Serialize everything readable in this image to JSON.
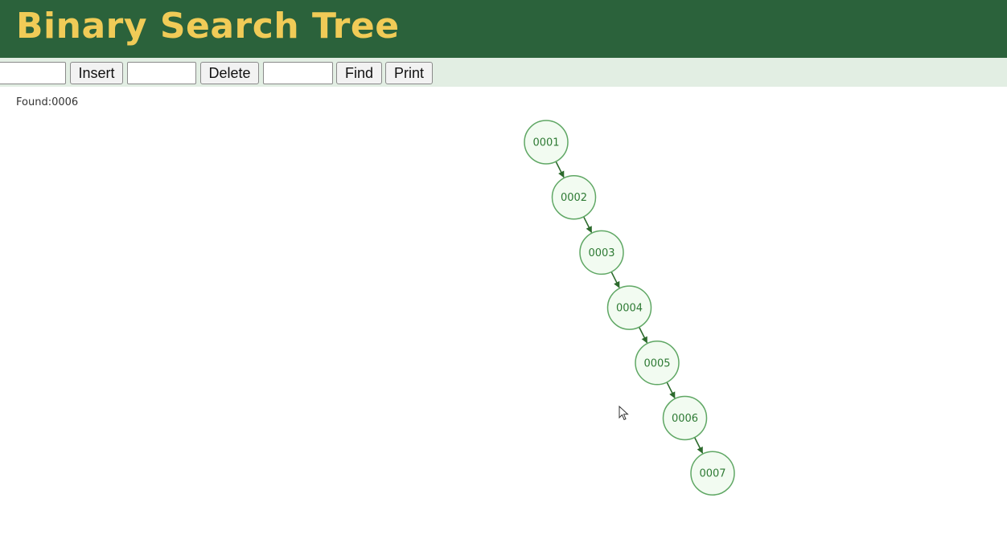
{
  "header": {
    "title": "Binary Search Tree",
    "background": "#2b623b",
    "title_color": "#f0cb57"
  },
  "toolbar": {
    "background": "#e2eee3",
    "insert_value": "",
    "insert_label": "Insert",
    "delete_value": "",
    "delete_label": "Delete",
    "find_value": "",
    "find_label": "Find",
    "print_label": "Print"
  },
  "status": {
    "text": "Found:0006"
  },
  "tree": {
    "node_fill": "#f2fbf1",
    "node_stroke": "#5fa764",
    "edge_color": "#2c6a2c",
    "nodes": [
      {
        "id": "0001",
        "label": "0001",
        "depth": 0,
        "parent": null
      },
      {
        "id": "0002",
        "label": "0002",
        "depth": 1,
        "parent": "0001"
      },
      {
        "id": "0003",
        "label": "0003",
        "depth": 2,
        "parent": "0002"
      },
      {
        "id": "0004",
        "label": "0004",
        "depth": 3,
        "parent": "0003"
      },
      {
        "id": "0005",
        "label": "0005",
        "depth": 4,
        "parent": "0004"
      },
      {
        "id": "0006",
        "label": "0006",
        "depth": 5,
        "parent": "0005"
      },
      {
        "id": "0007",
        "label": "0007",
        "depth": 6,
        "parent": "0006"
      }
    ]
  },
  "icons": {
    "cursor": "mouse-pointer-icon"
  }
}
